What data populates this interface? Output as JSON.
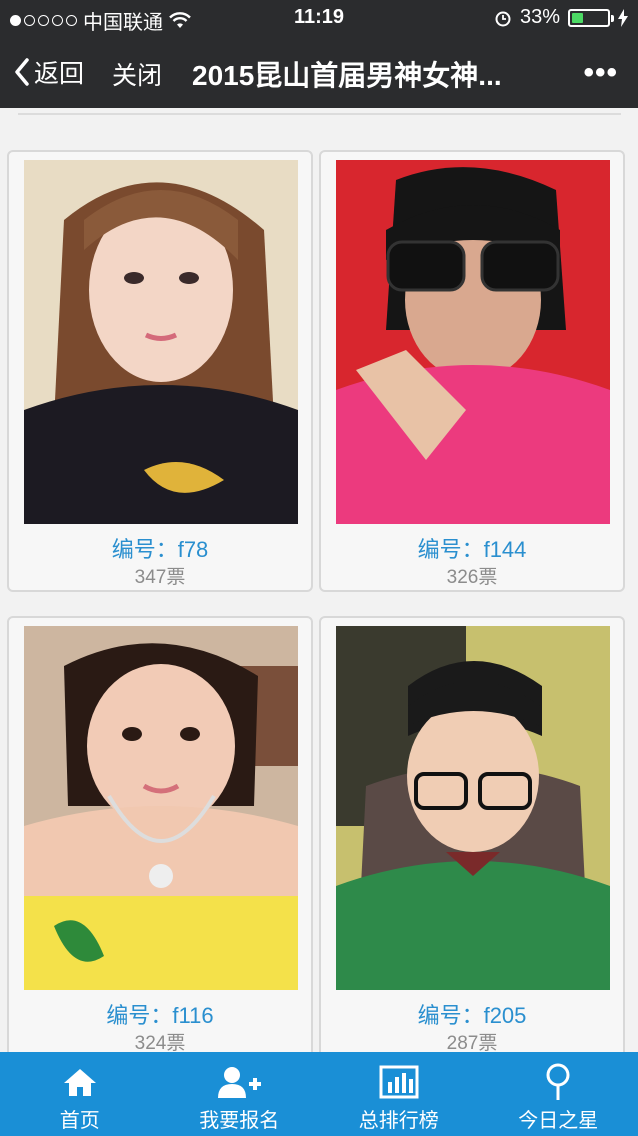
{
  "status_bar": {
    "carrier": "中国联通",
    "time": "11:19",
    "battery": "33%",
    "battery_level": 0.33
  },
  "nav": {
    "back_label": "返回",
    "close_label": "关闭",
    "title": "2015昆山首届男神女神...",
    "more_label": "•••"
  },
  "cards": [
    {
      "code": "编号：f78",
      "votes": "347票"
    },
    {
      "code": "编号：f144",
      "votes": "326票"
    },
    {
      "code": "编号：f116",
      "votes": "324票"
    },
    {
      "code": "编号：f205",
      "votes": "287票"
    }
  ],
  "tabs": [
    {
      "label": "首页",
      "icon": "home-icon"
    },
    {
      "label": "我要报名",
      "icon": "add-user-icon"
    },
    {
      "label": "总排行榜",
      "icon": "bar-chart-icon"
    },
    {
      "label": "今日之星",
      "icon": "location-pin-icon"
    }
  ],
  "colors": {
    "bar_bg": "#2b2c2e",
    "tab_bg": "#1a8fd6",
    "code_text": "#2a8fcf",
    "votes_text": "#8c8c8c"
  }
}
